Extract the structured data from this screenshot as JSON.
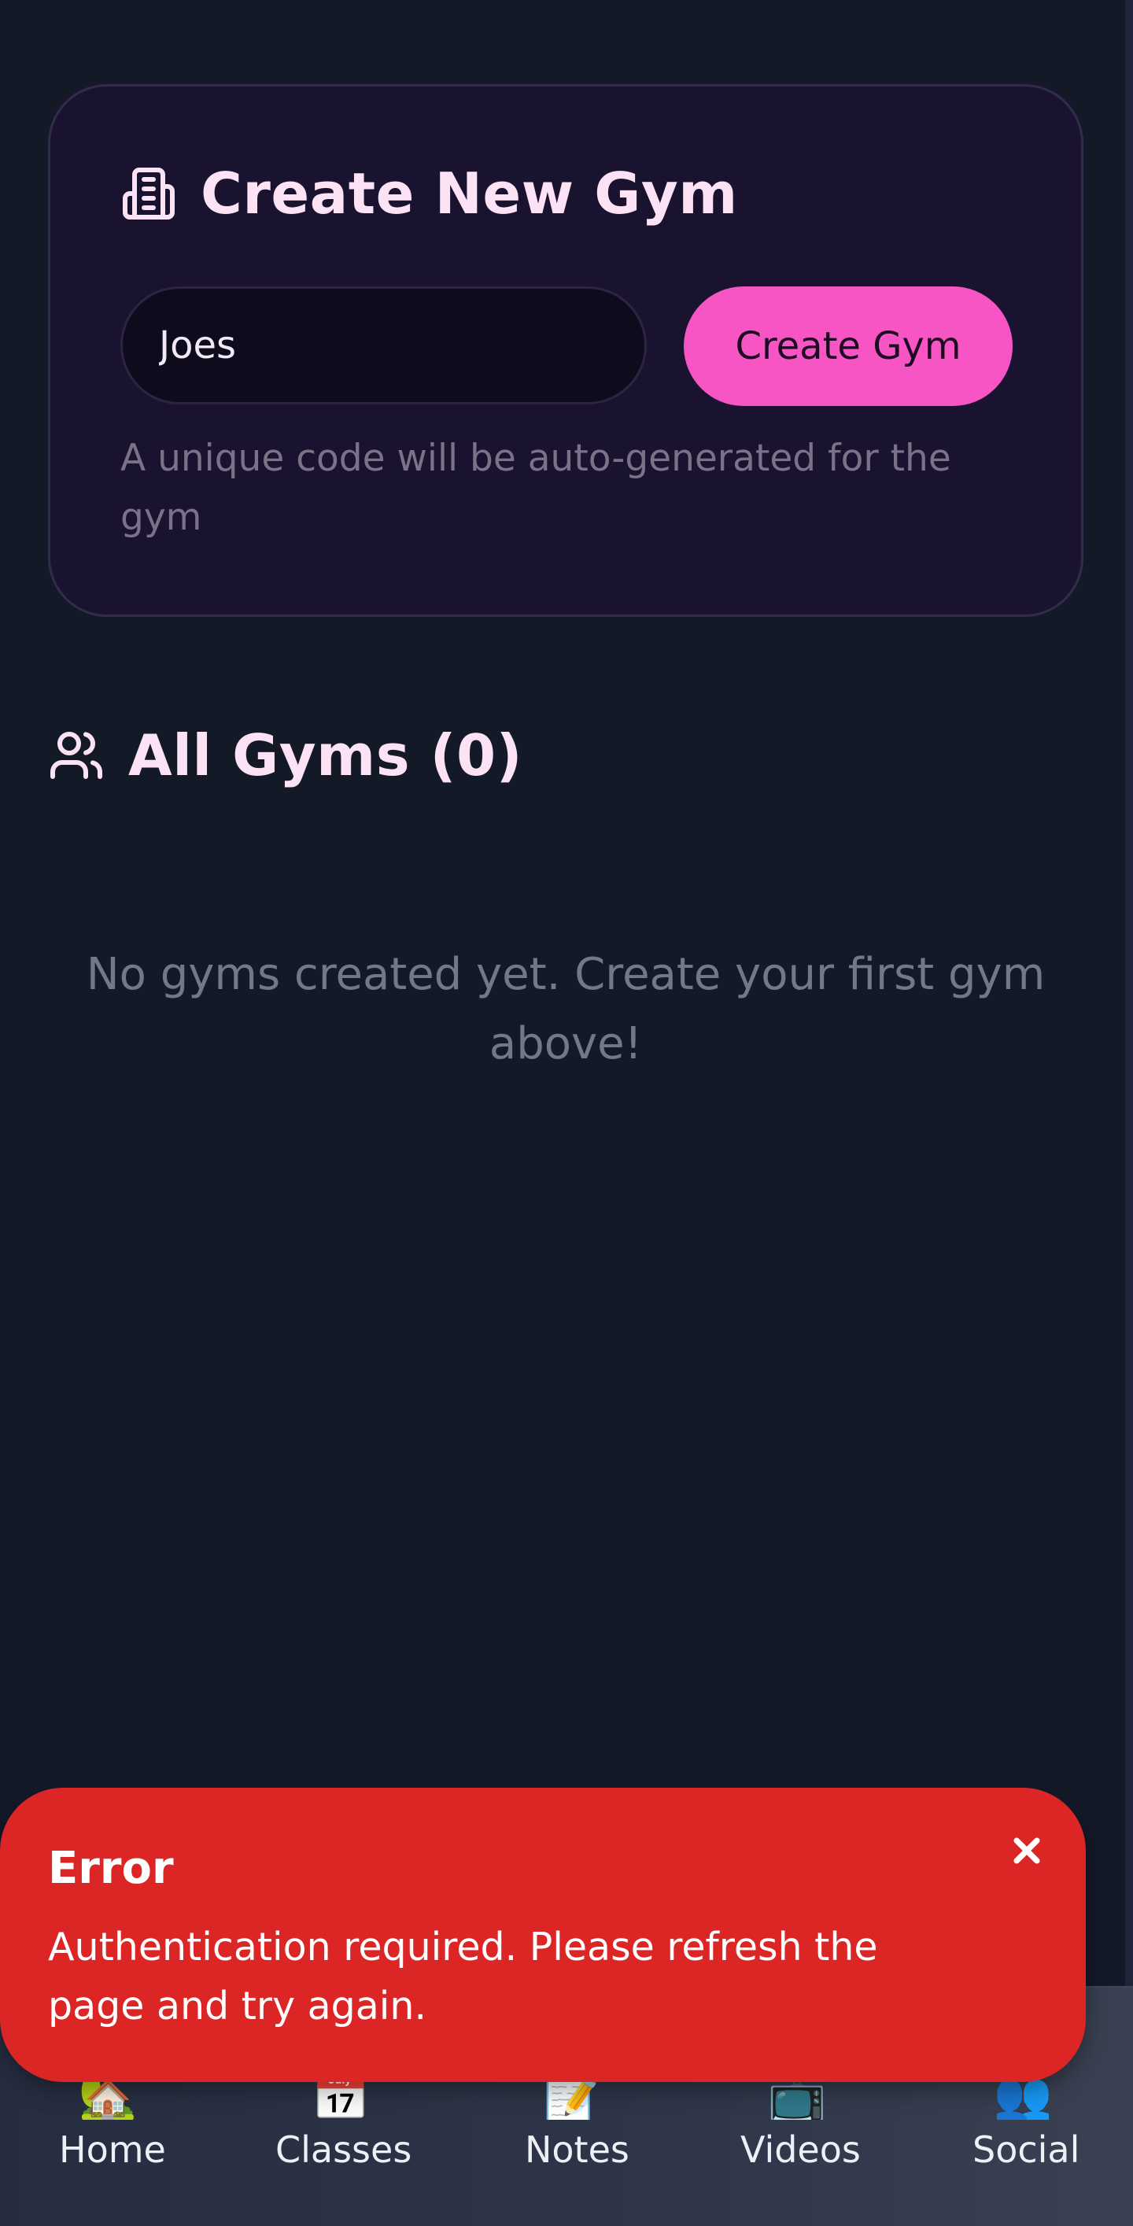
{
  "create_gym": {
    "title": "Create New Gym",
    "title_icon": "building-icon",
    "name_value": "Joes",
    "name_placeholder": "",
    "button_label": "Create Gym",
    "helper_text": "A unique code will be auto-generated for the gym"
  },
  "gyms": {
    "title": "All Gyms (0)",
    "title_icon": "users-icon",
    "count": 0,
    "empty_message": "No gyms created yet. Create your first gym above!"
  },
  "nav": {
    "items": [
      {
        "label": "Home",
        "icon": "house-icon"
      },
      {
        "label": "Classes",
        "icon": "calendar-icon"
      },
      {
        "label": "Notes",
        "icon": "memo-icon"
      },
      {
        "label": "Videos",
        "icon": "tv-icon"
      },
      {
        "label": "Social",
        "icon": "people-icon"
      }
    ]
  },
  "toast": {
    "title": "Error",
    "message": "Authentication required. Please refresh the page and try again.",
    "close_icon": "close-icon"
  },
  "colors": {
    "background": "#141928",
    "card": "#1a1330",
    "accent": "#f754c4",
    "error": "#dc2626",
    "heading": "#fbe3f5"
  }
}
